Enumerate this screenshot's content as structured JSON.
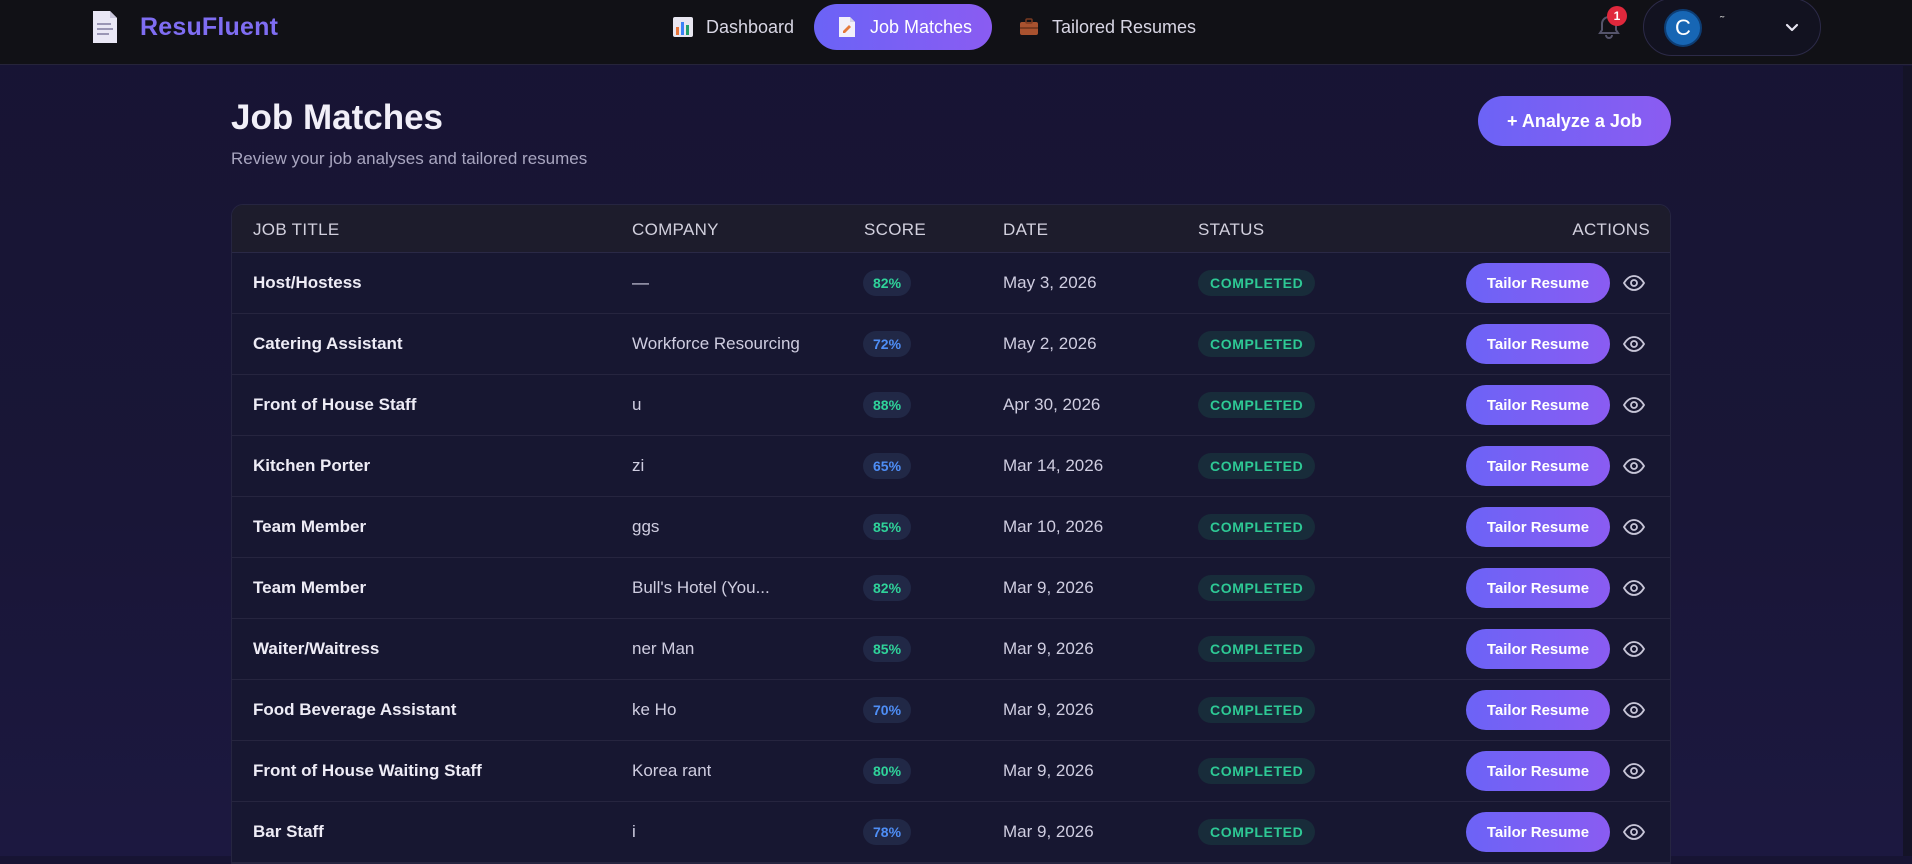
{
  "app": {
    "name": "ResuFluent"
  },
  "nav": {
    "items": [
      {
        "label": "Dashboard",
        "icon": "bar-chart-icon"
      },
      {
        "label": "Job Matches",
        "icon": "document-icon",
        "active": true
      },
      {
        "label": "Tailored Resumes",
        "icon": "briefcase-icon"
      }
    ]
  },
  "notifications": {
    "count": "1"
  },
  "user": {
    "initial": "C",
    "name": "˜"
  },
  "page": {
    "title": "Job Matches",
    "subtitle": "Review your job analyses and tailored resumes",
    "analyze_button": "+ Analyze a Job"
  },
  "table": {
    "headers": {
      "title": "JOB TITLE",
      "company": "COMPANY",
      "score": "SCORE",
      "date": "DATE",
      "status": "STATUS",
      "actions": "ACTIONS"
    },
    "action_label": "Tailor Resume",
    "rows": [
      {
        "title": "Host/Hostess",
        "company": "—",
        "score": "82%",
        "score_color": "green",
        "date": "May 3, 2026",
        "status": "COMPLETED"
      },
      {
        "title": "Catering Assistant",
        "company": "Workforce Resourcing",
        "score": "72%",
        "score_color": "blue",
        "date": "May 2, 2026",
        "status": "COMPLETED"
      },
      {
        "title": "Front of House Staff",
        "company": "u",
        "score": "88%",
        "score_color": "green",
        "date": "Apr 30, 2026",
        "status": "COMPLETED"
      },
      {
        "title": "Kitchen Porter",
        "company": "zi",
        "score": "65%",
        "score_color": "blue",
        "date": "Mar 14, 2026",
        "status": "COMPLETED"
      },
      {
        "title": "Team Member",
        "company": "ggs",
        "score": "85%",
        "score_color": "green",
        "date": "Mar 10, 2026",
        "status": "COMPLETED"
      },
      {
        "title": "Team Member",
        "company": "Bull's Hotel (You...",
        "score": "82%",
        "score_color": "green",
        "date": "Mar 9, 2026",
        "status": "COMPLETED"
      },
      {
        "title": "Waiter/Waitress",
        "company": "ner Man",
        "score": "85%",
        "score_color": "green",
        "date": "Mar 9, 2026",
        "status": "COMPLETED"
      },
      {
        "title": "Food Beverage Assistant",
        "company": "ke Ho",
        "score": "70%",
        "score_color": "blue",
        "date": "Mar 9, 2026",
        "status": "COMPLETED"
      },
      {
        "title": "Front of House Waiting Staff",
        "company": "Korea rant",
        "score": "80%",
        "score_color": "green",
        "date": "Mar 9, 2026",
        "status": "COMPLETED"
      },
      {
        "title": "Bar Staff",
        "company": "i",
        "score": "78%",
        "score_color": "blue",
        "date": "Mar 9, 2026",
        "status": "COMPLETED"
      }
    ]
  },
  "colors": {
    "accent": "#7b61f5",
    "score_green": "#2fd39a",
    "score_blue": "#4e8ef6",
    "status_green": "#2ec995",
    "badge_red": "#e0283c"
  }
}
